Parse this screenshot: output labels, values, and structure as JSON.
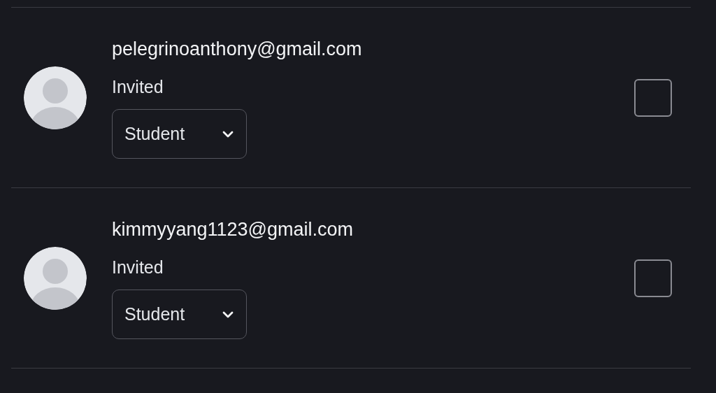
{
  "members": [
    {
      "email": "pelegrinoanthony@gmail.com",
      "status": "Invited",
      "role": "Student",
      "checked": false
    },
    {
      "email": "kimmyyang1123@gmail.com",
      "status": "Invited",
      "role": "Student",
      "checked": false
    }
  ]
}
